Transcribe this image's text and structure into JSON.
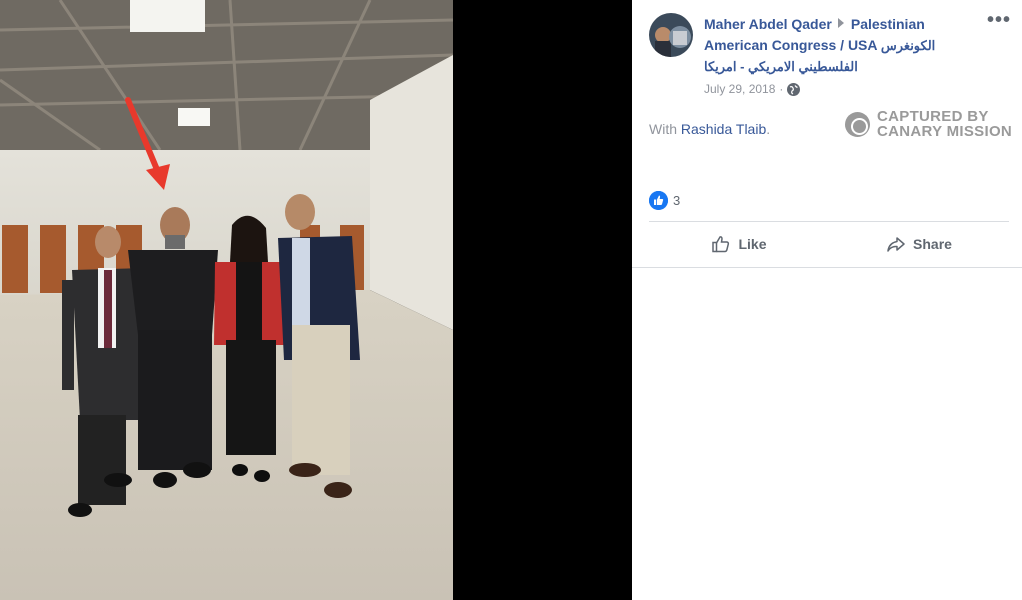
{
  "post": {
    "author": "Maher Abdel Qader",
    "group_line1": "Palestinian",
    "group_line2": "American Congress / USA",
    "group_arabic_1": "الكونغرس",
    "group_arabic_2": "الفلسطيني الامريكي - امريكا",
    "date": "July 29, 2018",
    "more_label": "•••",
    "with_prefix": "With",
    "with_name": "Rashida Tlaib",
    "with_suffix": "."
  },
  "watermark": {
    "line1": "CAPTURED BY",
    "line2": "CANARY MISSION"
  },
  "reactions": {
    "count": "3"
  },
  "actions": {
    "like": "Like",
    "share": "Share"
  },
  "icons": {
    "more": "more-options-icon",
    "privacy": "globe-icon",
    "reaction": "thumbs-up-icon",
    "like": "like-icon",
    "share": "share-icon"
  },
  "colors": {
    "link": "#385898",
    "meta": "#90949c",
    "reaction_blue": "#1877f2",
    "arrow_red": "#e8392c"
  }
}
